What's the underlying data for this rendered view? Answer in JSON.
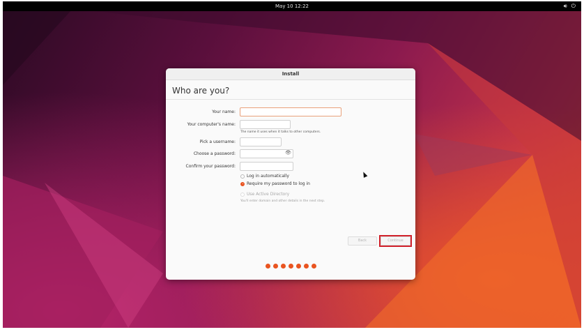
{
  "topbar": {
    "clock": "May 10  12:22",
    "icons": [
      "speaker-icon",
      "power-icon"
    ]
  },
  "window": {
    "title": "Install",
    "page_title": "Who are you?"
  },
  "form": {
    "your_name_label": "Your name:",
    "your_name_value": "",
    "computer_name_label": "Your computer's name:",
    "computer_name_value": "",
    "computer_name_hint": "The name it uses when it talks to other computers.",
    "username_label": "Pick a username:",
    "username_value": "",
    "password_label": "Choose a password:",
    "password_value": "",
    "confirm_label": "Confirm your password:",
    "confirm_value": ""
  },
  "options": {
    "login_auto": "Log in automatically",
    "require_password": "Require my password to log in",
    "selected": "require_password",
    "active_directory": "Use Active Directory",
    "active_directory_hint": "You'll enter domain and other details in the next step."
  },
  "buttons": {
    "back": "Back",
    "continue": "Continue"
  },
  "progress": {
    "steps_shown": 7
  },
  "colors": {
    "accent": "#e95420",
    "highlight": "#d0202a"
  }
}
